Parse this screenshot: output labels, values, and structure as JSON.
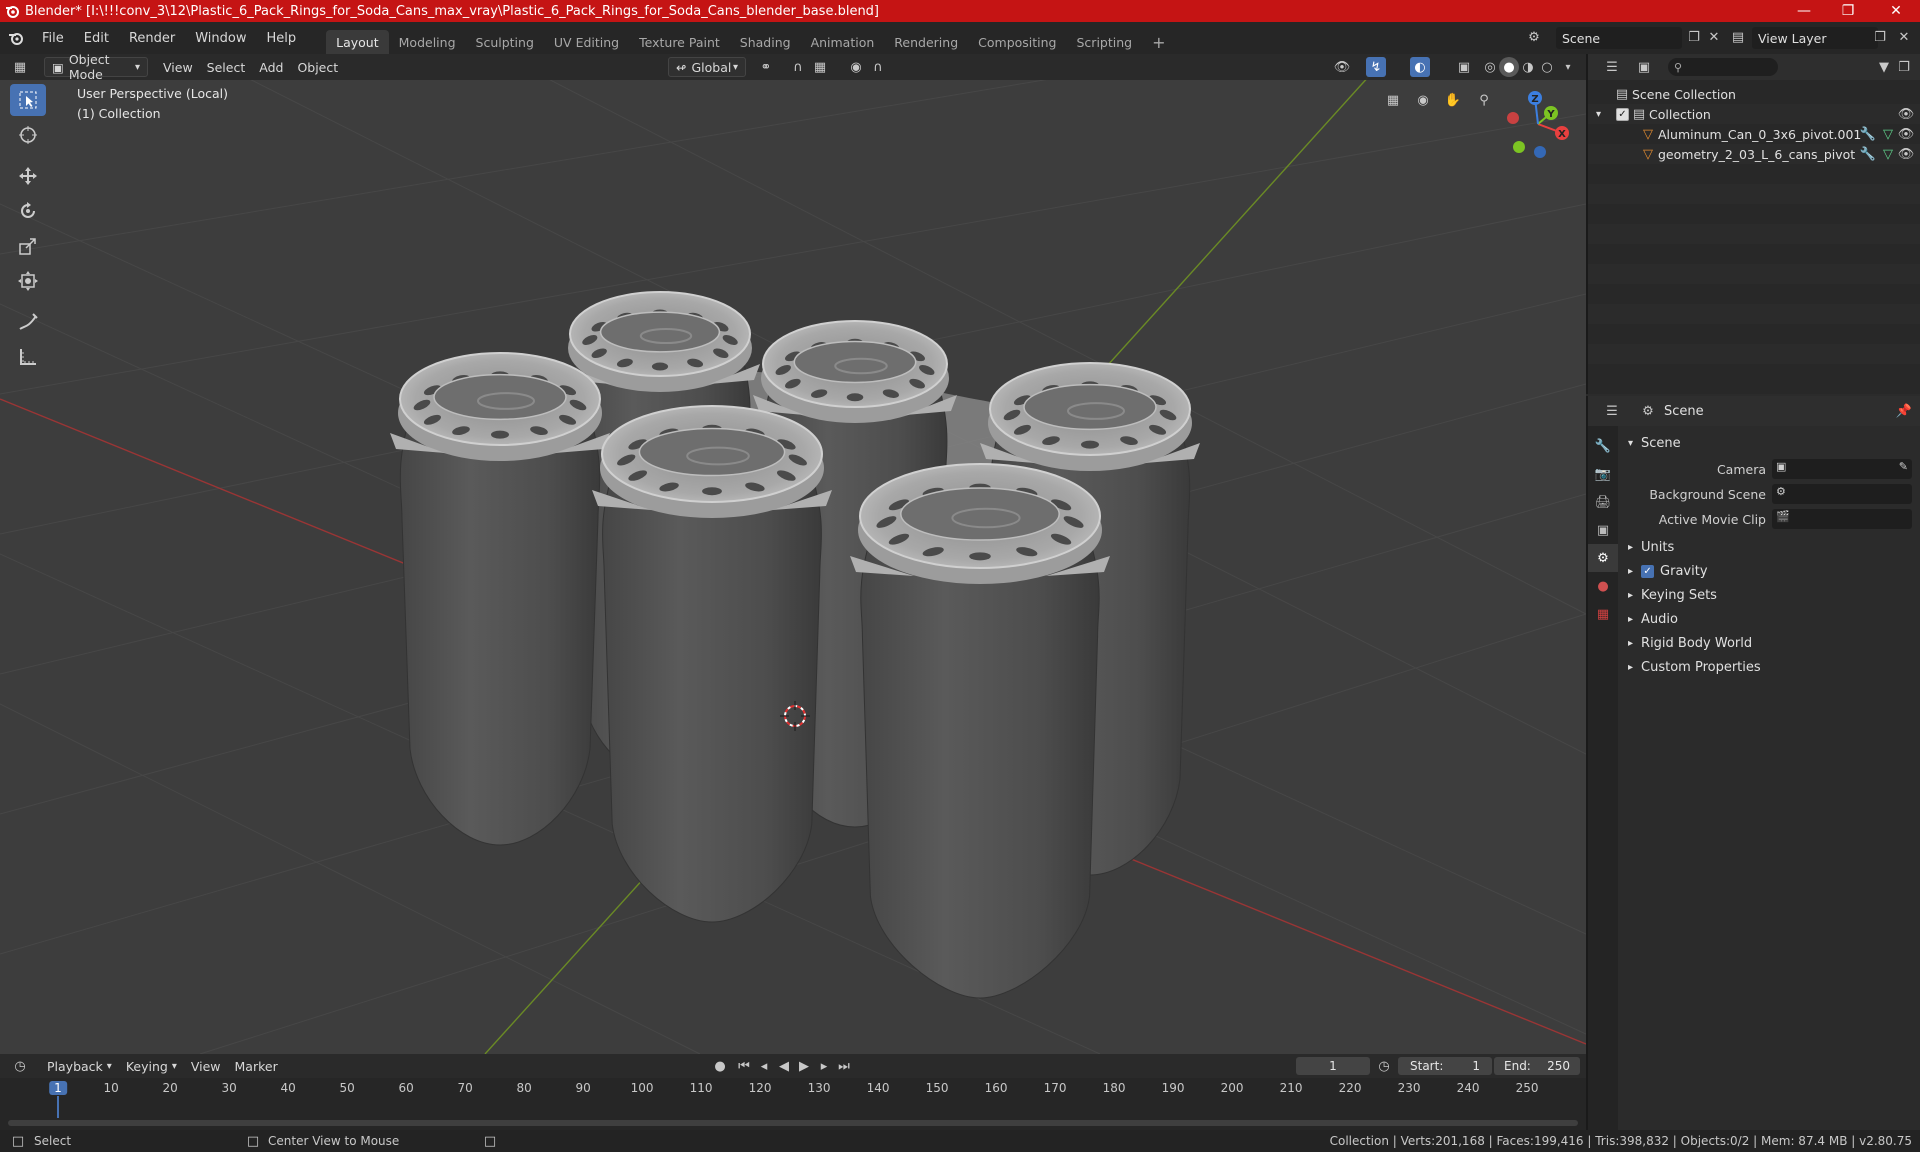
{
  "titlebar": {
    "title": "Blender* [I:\\!!!conv_3\\12\\Plastic_6_Pack_Rings_for_Soda_Cans_max_vray\\Plastic_6_Pack_Rings_for_Soda_Cans_blender_base.blend]"
  },
  "menu": {
    "items": [
      "File",
      "Edit",
      "Render",
      "Window",
      "Help"
    ]
  },
  "workspaces": [
    "Layout",
    "Modeling",
    "Sculpting",
    "UV Editing",
    "Texture Paint",
    "Shading",
    "Animation",
    "Rendering",
    "Compositing",
    "Scripting"
  ],
  "scene_selector": {
    "value": "Scene"
  },
  "view_layer_selector": {
    "value": "View Layer"
  },
  "viewport": {
    "mode": "Object Mode",
    "menus": [
      "View",
      "Select",
      "Add",
      "Object"
    ],
    "transform_orientation": "Global",
    "perspective_label": "User Perspective (Local)",
    "collection_label": "(1) Collection",
    "gizmo_axes": {
      "x": "X",
      "y": "Y",
      "z": "Z"
    }
  },
  "outliner": {
    "scene_collection": "Scene Collection",
    "collection": "Collection",
    "objects": [
      "Aluminum_Can_0_3x6_pivot.001",
      "geometry_2_03_L_6_cans_pivot"
    ]
  },
  "properties": {
    "header_title": "Scene",
    "section": "Scene",
    "fields": {
      "camera": "Camera",
      "background_scene": "Background Scene",
      "active_movie_clip": "Active Movie Clip"
    },
    "panels": [
      "Units",
      "Gravity",
      "Keying Sets",
      "Audio",
      "Rigid Body World",
      "Custom Properties"
    ]
  },
  "timeline": {
    "menus": [
      "Playback",
      "Keying",
      "View",
      "Marker"
    ],
    "current_frame": "1",
    "start_label": "Start:",
    "start_value": "1",
    "end_label": "End:",
    "end_value": "250",
    "ruler_labels": [
      "1",
      "10",
      "20",
      "30",
      "40",
      "50",
      "60",
      "70",
      "80",
      "90",
      "100",
      "110",
      "120",
      "130",
      "140",
      "150",
      "160",
      "170",
      "180",
      "190",
      "200",
      "210",
      "220",
      "230",
      "240",
      "250"
    ]
  },
  "statusbar": {
    "left_action": "Select",
    "middle_action": "Center View to Mouse",
    "stats": "Collection | Verts:201,168 | Faces:199,416 | Tris:398,832 | Objects:0/2 | Mem: 87.4 MB | v2.80.75"
  },
  "colors": {
    "title_bg": "#c51414",
    "accent": "#4772b3",
    "viewport_bg": "#3d3d3d",
    "x_axis": "#e8403f",
    "y_axis": "#7cc423",
    "z_axis": "#3c7fe0"
  }
}
